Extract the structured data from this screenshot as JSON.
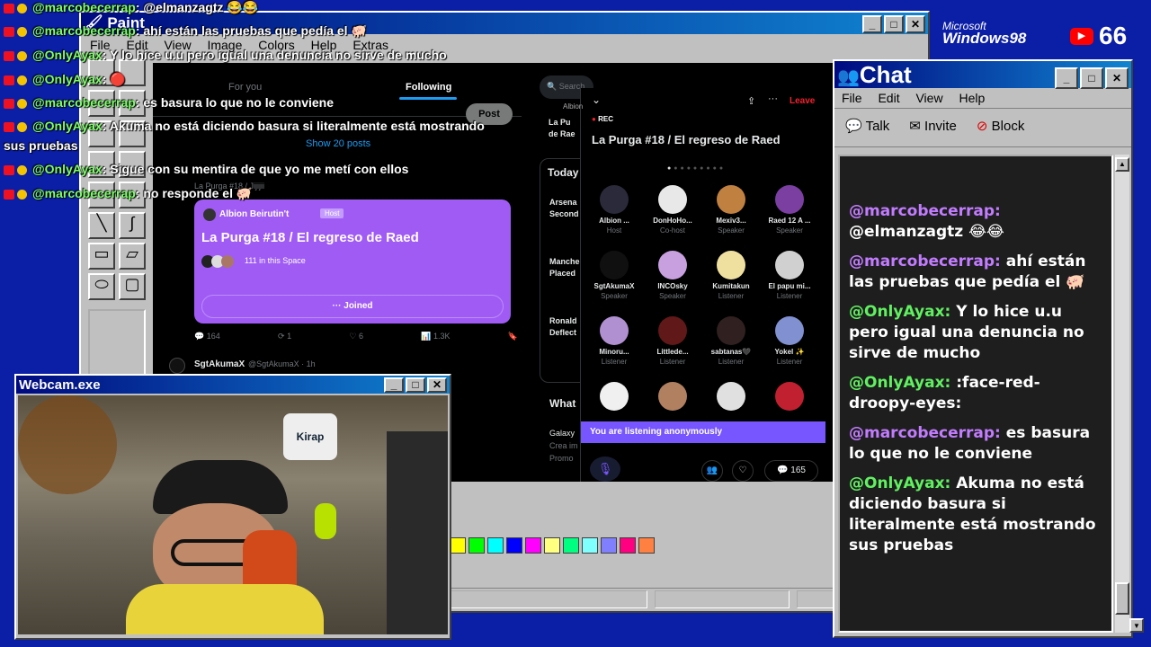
{
  "overlay_chat": [
    {
      "user": "@marcobecerrap",
      "text": ": @elmanzagtz 😂😂"
    },
    {
      "user": "@marcobecerrap",
      "text": ": ahí están las pruebas que pedía el 🐖"
    },
    {
      "user": "@OnlyAyax",
      "text": ": Y lo hice u.u pero igual una denuncia no sirve de mucho"
    },
    {
      "user": "@OnlyAyax",
      "text": ": 🔴"
    },
    {
      "user": "@marcobecerrap",
      "text": ": es basura lo que no le conviene"
    },
    {
      "user": "@OnlyAyax",
      "text": ": Akuma no está diciendo basura si literalmente está mostrando"
    },
    {
      "user": "",
      "text": "sus pruebas"
    },
    {
      "user": "@OnlyAyax",
      "text": ": Sigue con su mentira de que yo me metí con ellos"
    },
    {
      "user": "@marcobecerrap",
      "text": ": no responde el 🐖"
    }
  ],
  "paint": {
    "title": "Paint",
    "menu": [
      "File",
      "Edit",
      "View",
      "Image",
      "Colors",
      "Help",
      "Extras"
    ]
  },
  "branding": {
    "microsoft": "Microsoft",
    "windows": "Windows98",
    "yt_count": "66"
  },
  "twitter": {
    "tab_foryou": "For you",
    "tab_following": "Following",
    "post": "Post",
    "show_posts": "Show 20 posts",
    "search": "Search",
    "reply_line": "La Purga #18 / Jijijii",
    "card": {
      "host": "Albion Beirutin't",
      "host_badge": "Host",
      "title": "La Purga #18 / El regreso de Raed",
      "count": "111 in this Space",
      "joined": "Joined"
    },
    "stats": {
      "replies": "164",
      "retweets": "1",
      "likes": "6",
      "views": "1.3K"
    },
    "next_user": "SgtAkumaX",
    "next_handle": "@SgtAkumaX · 1h",
    "today": "Today",
    "trends": [
      "Arsena",
      "Second",
      "Manche",
      "Placed",
      "Ronald",
      "Deflect"
    ],
    "whats": "What",
    "galaxy": [
      "Galaxy",
      "Crea im",
      "Promo"
    ],
    "albion_snip": "Albion",
    "raed_snip": [
      "La Pu",
      "de Rae"
    ]
  },
  "space_panel": {
    "leave": "Leave",
    "rec": "REC",
    "title": "La Purga #18 / El regreso de Raed",
    "participants": [
      {
        "name": "Albion ...",
        "role": "Host",
        "color": "#2a2a3a"
      },
      {
        "name": "DonHoHo...",
        "role": "Co-host",
        "color": "#e8e8e8"
      },
      {
        "name": "Mexiv3...",
        "role": "Speaker",
        "color": "#c08040"
      },
      {
        "name": "Raed 12 A ...",
        "role": "Speaker",
        "color": "#7a3fa0"
      },
      {
        "name": "SgtAkumaX",
        "role": "Speaker",
        "color": "#101010"
      },
      {
        "name": "INCOsky",
        "role": "Speaker",
        "color": "#c8a0e0"
      },
      {
        "name": "Kumitakun",
        "role": "Listener",
        "color": "#f0e0a0"
      },
      {
        "name": "El papu mi...",
        "role": "Listener",
        "color": "#d0d0d0"
      },
      {
        "name": "Minoru...",
        "role": "Listener",
        "color": "#b090d0"
      },
      {
        "name": "Littlede...",
        "role": "Listener",
        "color": "#601818"
      },
      {
        "name": "sabtanas🖤",
        "role": "Listener",
        "color": "#302020"
      },
      {
        "name": "Yokel ✨",
        "role": "Listener",
        "color": "#8090d0"
      },
      {
        "name": "",
        "role": "",
        "color": "#f0f0f0"
      },
      {
        "name": "",
        "role": "",
        "color": "#b08060"
      },
      {
        "name": "",
        "role": "",
        "color": "#e0e0e0"
      },
      {
        "name": "",
        "role": "",
        "color": "#c02030"
      }
    ],
    "anon": "You are listening anonymously",
    "comments": "165"
  },
  "webcam": {
    "title": "Webcam.exe",
    "poster_text": "Kirap"
  },
  "chat": {
    "title": "Chat",
    "menu": [
      "File",
      "Edit",
      "View",
      "Help"
    ],
    "toolbar": [
      "Talk",
      "Invite",
      "Block"
    ],
    "messages": [
      {
        "user": "@marcobecerrap:",
        "text": " @elmanzagtz 😂😂",
        "style": "p"
      },
      {
        "user": "@marcobecerrap:",
        "text": " ahí están las pruebas que pedía el 🐖",
        "style": "p"
      },
      {
        "user": "@OnlyAyax:",
        "text": " Y lo hice u.u pero igual una denuncia no sirve de mucho",
        "style": "g"
      },
      {
        "user": "@OnlyAyax:",
        "text": " :face-red-droopy-eyes:",
        "style": "g"
      },
      {
        "user": "@marcobecerrap:",
        "text": " es basura lo que no le conviene",
        "style": "p"
      },
      {
        "user": "@OnlyAyax:",
        "text": " Akuma no está diciendo basura si literalmente está mostrando sus pruebas",
        "style": "g"
      }
    ]
  },
  "palette": [
    "#ffff00",
    "#00ff00",
    "#00ffff",
    "#0000ff",
    "#ff00ff",
    "#ffff80",
    "#00ff80",
    "#80ffff",
    "#8080ff",
    "#ff0080",
    "#ff8040"
  ]
}
